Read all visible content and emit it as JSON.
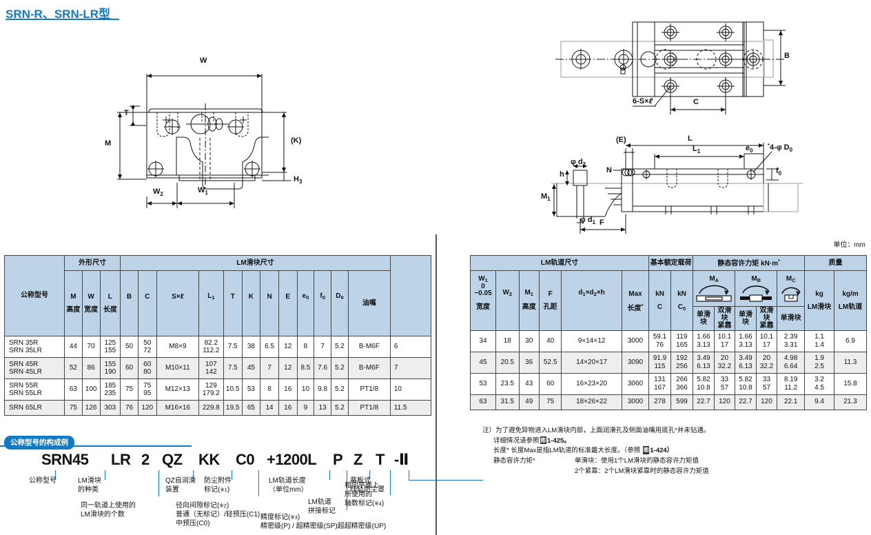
{
  "page": {
    "title": "SRN-R、SRN-LR型",
    "unit_note": "单位：mm"
  },
  "drawings": {
    "front_view": {
      "labels": [
        "W",
        "T",
        "M",
        "(K)",
        "H₃",
        "W₂",
        "W₁"
      ]
    },
    "plan_view": {
      "labels": [
        "B",
        "6-S×ℓ",
        "C"
      ]
    },
    "side_view": {
      "labels": [
        "(E)",
        "L",
        "L₁",
        "e₀",
        "4-φ D₀",
        "φ d₂",
        "N",
        "h",
        "M₁",
        "φ d₁",
        "F",
        "f₀"
      ]
    }
  },
  "left_table": {
    "group_headers": {
      "model": "公称型号",
      "outer": "外形尺寸",
      "block": "LM滑块尺寸"
    },
    "columns": [
      {
        "label": "高度",
        "sym": "M"
      },
      {
        "label": "宽度",
        "sym": "W"
      },
      {
        "label": "长度",
        "sym": "L"
      },
      {
        "label": "",
        "sym": "B"
      },
      {
        "label": "",
        "sym": "C"
      },
      {
        "label": "",
        "sym": "S×ℓ"
      },
      {
        "label": "",
        "sym": "L₁"
      },
      {
        "label": "",
        "sym": "T"
      },
      {
        "label": "",
        "sym": "K"
      },
      {
        "label": "",
        "sym": "N"
      },
      {
        "label": "",
        "sym": "E"
      },
      {
        "label": "",
        "sym": "e₀"
      },
      {
        "label": "",
        "sym": "f₀"
      },
      {
        "label": "",
        "sym": "D₀"
      },
      {
        "label": "油嘴",
        "sym": ""
      },
      {
        "label": "",
        "sym": "H₃"
      }
    ],
    "rows": [
      {
        "model": "SRN  35R\nSRN  35LR",
        "M": "44",
        "W": "70",
        "L": "125\n155",
        "B": "50",
        "C": "50\n72",
        "Sxl": "M8×9",
        "L1": "82.2\n112.2",
        "T": "7.5",
        "K": "38",
        "N": "6.5",
        "E": "12",
        "e0": "8",
        "f0": "7",
        "D0": "5.2",
        "grease": "B-M6F",
        "H3": "6"
      },
      {
        "model": "SRN  45R\nSRN  45LR",
        "M": "52",
        "W": "86",
        "L": "155\n190",
        "B": "60",
        "C": "60\n80",
        "Sxl": "M10×11",
        "L1": "107\n142",
        "T": "7.5",
        "K": "45",
        "N": "7",
        "E": "12",
        "e0": "8.5",
        "f0": "7.6",
        "D0": "5.2",
        "grease": "B-M6F",
        "H3": "7"
      },
      {
        "model": "SRN  55R\nSRN  55LR",
        "M": "63",
        "W": "100",
        "L": "185\n235",
        "B": "75",
        "C": "75\n95",
        "Sxl": "M12×13",
        "L1": "129\n179.2",
        "T": "10.5",
        "K": "53",
        "N": "8",
        "E": "16",
        "e0": "10",
        "f0": "9.8",
        "D0": "5.2",
        "grease": "PT1/8",
        "H3": "10"
      },
      {
        "model": "SRN  65LR",
        "M": "75",
        "W": "126",
        "L": "303",
        "B": "76",
        "C": "120",
        "Sxl": "M16×16",
        "L1": "229.8",
        "T": "19.5",
        "K": "65",
        "N": "14",
        "E": "16",
        "e0": "9",
        "f0": "13",
        "D0": "5.2",
        "grease": "PT1/8",
        "H3": "11.5"
      }
    ]
  },
  "right_table": {
    "group_headers": {
      "rail": "LM轨道尺寸",
      "load": "基本额定载荷",
      "moment": "静态容许力矩  kN·m",
      "mass": "质量"
    },
    "columns": [
      {
        "label": "宽度",
        "sym": "W₁\n0\n−0.05"
      },
      {
        "label": "",
        "sym": "W₂"
      },
      {
        "label": "高度",
        "sym": "M₁"
      },
      {
        "label": "孔距",
        "sym": "F"
      },
      {
        "label": "",
        "sym": "d₁×d₂×h"
      },
      {
        "label": "长度*",
        "sym": "Max"
      },
      {
        "label": "C",
        "sym": "kN"
      },
      {
        "label": "C₀",
        "sym": "kN"
      },
      {
        "label": "MA",
        "sym": "单滑块"
      },
      {
        "label": "MA",
        "sym": "双滑块\n紧靠"
      },
      {
        "label": "MB",
        "sym": "单滑块"
      },
      {
        "label": "MB",
        "sym": "双滑块\n紧靠"
      },
      {
        "label": "MC",
        "sym": "单滑块"
      },
      {
        "label": "LM滑块",
        "sym": "kg"
      },
      {
        "label": "LM轨道",
        "sym": "kg/m"
      }
    ],
    "moment_labels": {
      "ma": "M",
      "ma_sub": "A",
      "mb": "M",
      "mb_sub": "B",
      "mc": "M",
      "mc_sub": "C"
    },
    "single_block": "单滑块",
    "double_block": "双滑块\n紧靠",
    "rows": [
      {
        "W1": "34",
        "W2": "18",
        "M1": "30",
        "F": "40",
        "d1d2h": "9×14×12",
        "max": "3000",
        "C": "59.1\n76",
        "C0": "119\n165",
        "MA1": "1.66\n3.13",
        "MA2": "10.1\n17",
        "MB1": "1.66\n3.13",
        "MB2": "10.1\n17",
        "MC1": "2.39\n3.31",
        "mass_block": "1.1\n1.4",
        "mass_rail": "6.9"
      },
      {
        "W1": "45",
        "W2": "20.5",
        "M1": "36",
        "F": "52.5",
        "d1d2h": "14×20×17",
        "max": "3090",
        "C": "91.9\n115",
        "C0": "192\n256",
        "MA1": "3.49\n6.13",
        "MA2": "20\n32.2",
        "MB1": "3.49\n6.13",
        "MB2": "20\n32.2",
        "MC1": "4.98\n6.64",
        "mass_block": "1.9\n2.5",
        "mass_rail": "11.3"
      },
      {
        "W1": "53",
        "W2": "23.5",
        "M1": "43",
        "F": "60",
        "d1d2h": "16×23×20",
        "max": "3060",
        "C": "131\n167",
        "C0": "266\n366",
        "MA1": "5.82\n10.8",
        "MA2": "33\n57",
        "MB1": "5.82\n10.8",
        "MB2": "33\n57",
        "MC1": "8.19\n11.2",
        "mass_block": "3.2\n4.5",
        "mass_rail": "15.8"
      },
      {
        "W1": "63",
        "W2": "31.5",
        "M1": "49",
        "F": "75",
        "d1d2h": "18×26×22",
        "max": "3000",
        "C": "278",
        "C0": "599",
        "MA1": "22.7",
        "MA2": "120",
        "MB1": "22.7",
        "MB2": "120",
        "MC1": "22.1",
        "mass_block": "9.4",
        "mass_rail": "21.3"
      }
    ]
  },
  "designation": {
    "badge": "公称型号的构成例",
    "tokens": [
      "SRN45",
      "LR",
      "2",
      "QZ",
      "KK",
      "C0",
      "+1200L",
      "P",
      "Z",
      "T",
      "-Ⅱ"
    ],
    "notes": {
      "model": "公称型号",
      "block_type": "LM滑块\n的种类",
      "qz": "QZ自润滑\n装置",
      "dust": "防尘附件\n标记(※1)",
      "rail_len": "LM轨道长度\n（单位mm）",
      "band": "蒂板式\n线轨防尘罩",
      "same_plane": "相同平面上\n所使用的\n轴数标记(※4)",
      "block_count": "同一轨道上使用的\nLM滑块的个数",
      "clearance": "径向间隙标记(※2)\n普通（无标记）/轻预压(C1)\n中预压(C0)",
      "rail_join": "LM轨道\n拼接标记",
      "accuracy": "精度标记(※3)\n精密级(P) / 超精密级(SP)超超精密级(UP)"
    }
  },
  "notes": {
    "line1": "注）为了避免异物进入LM滑块内部，上面润滑孔及侧面油嘴用底孔*并未钻通。",
    "line2_pre": "详细情况请参照",
    "line2_ref": "图",
    "line2_post": "1-425。",
    "line3_pre": "长度*  长度Max是指LM轨道的标准最大长度。（参照  ",
    "line3_ref": "图",
    "line3_post": "1-424）",
    "line4_label": "静态容许力矩*",
    "line4_a": "单滑块：使用1个LM滑块的静态容许力矩值",
    "line4_b": "2个紧靠：2个LM滑块紧靠时的静态容许力矩值"
  },
  "colors": {
    "brand": "#1279c4",
    "header_fill": "#bdd4e8",
    "alt_row": "#eeeeee"
  }
}
